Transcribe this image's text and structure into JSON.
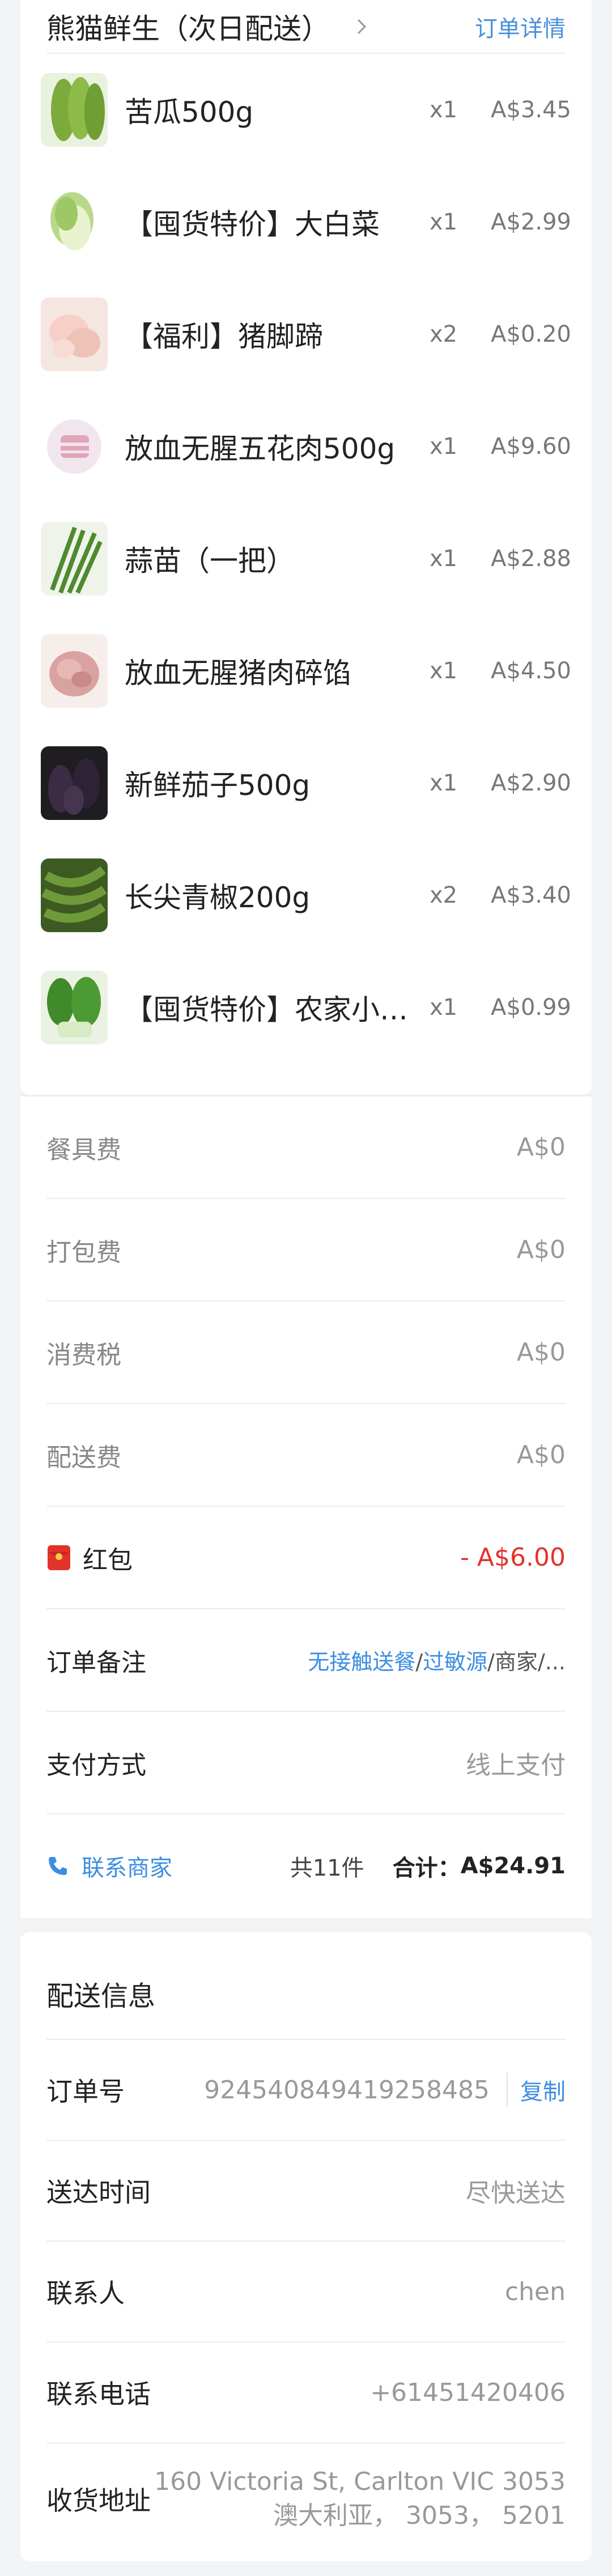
{
  "store": {
    "name": "熊猫鲜生（次日配送）",
    "order_detail_link": "订单详情"
  },
  "items": [
    {
      "name": "苦瓜500g",
      "qty": "x1",
      "price": "A$3.45",
      "icon": "bitter-melon"
    },
    {
      "name": "【囤货特价】大白菜",
      "qty": "x1",
      "price": "A$2.99",
      "icon": "napa-cabbage"
    },
    {
      "name": "【福利】猪脚蹄",
      "qty": "x2",
      "price": "A$0.20",
      "icon": "pork-trotter"
    },
    {
      "name": "放血无腥五花肉500g",
      "qty": "x1",
      "price": "A$9.60",
      "icon": "pork-belly"
    },
    {
      "name": "蒜苗（一把）",
      "qty": "x1",
      "price": "A$2.88",
      "icon": "garlic-sprouts"
    },
    {
      "name": "放血无腥猪肉碎馅",
      "qty": "x1",
      "price": "A$4.50",
      "icon": "minced-pork"
    },
    {
      "name": "新鲜茄子500g",
      "qty": "x1",
      "price": "A$2.90",
      "icon": "eggplant"
    },
    {
      "name": "长尖青椒200g",
      "qty": "x2",
      "price": "A$3.40",
      "icon": "green-pepper"
    },
    {
      "name": "【囤货特价】农家小白菜",
      "qty": "x1",
      "price": "A$0.99",
      "icon": "bok-choy"
    }
  ],
  "fees": {
    "tableware": {
      "label": "餐具费",
      "value": "A$0"
    },
    "packing": {
      "label": "打包费",
      "value": "A$0"
    },
    "tax": {
      "label": "消费税",
      "value": "A$0"
    },
    "delivery": {
      "label": "配送费",
      "value": "A$0"
    },
    "red_packet": {
      "label": "红包",
      "value": "- A$6.00"
    },
    "note": {
      "label": "订单备注",
      "value_link1": "无接触送餐",
      "sep1": "/",
      "value_link2": "过敏源",
      "value_rest": "/商家/..."
    },
    "payment": {
      "label": "支付方式",
      "value": "线上支付"
    }
  },
  "summary": {
    "contact_label": "联系商家",
    "count_text": "共11件",
    "total_label": "合计：",
    "total_value": "A$24.91"
  },
  "delivery_info": {
    "title": "配送信息",
    "order_no_label": "订单号",
    "order_no_value": "924540849419258485",
    "copy_label": "复制",
    "time_label": "送达时间",
    "time_value": "尽快送达",
    "contact_label": "联系人",
    "contact_value": "chen",
    "phone_label": "联系电话",
    "phone_value": "+61451420406",
    "address_label": "收货地址",
    "address_line1": "160 Victoria St, Carlton VIC 3053",
    "address_line2": "澳大利亚， 3053， 5201"
  },
  "colors": {
    "accent": "#3d8ee0",
    "red": "#e2332b",
    "background": "#f2f3f5"
  }
}
